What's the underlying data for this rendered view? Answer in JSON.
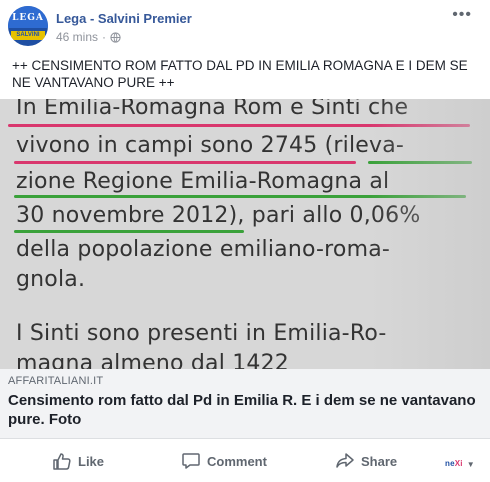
{
  "header": {
    "page_name": "Lega - Salvini Premier",
    "time": "46 mins",
    "dot": "·",
    "avatar_text": "LEGA",
    "avatar_band": "SALVINI"
  },
  "post": {
    "text": "++ CENSIMENTO ROM FATTO DAL PD IN EMILIA ROMAGNA E I DEM SE NE VANTAVANO PURE ++"
  },
  "photo": {
    "lines": [
      "In Emilia-Romagna Rom e Sinti che",
      "vivono in campi sono 2745 (rileva-",
      "zione Regione Emilia-Romagna al",
      "30 novembre 2012), pari allo 0,06%",
      "della popolazione emiliano-roma-",
      "gnola.",
      "I Sinti sono presenti in Emilia-Ro-",
      "magna almeno dal 1422"
    ]
  },
  "link": {
    "domain": "AFFARITALIANI.IT",
    "title": "Censimento rom fatto dal Pd in Emilia R. E i dem se ne vantavano pure. Foto"
  },
  "actions": {
    "like": "Like",
    "comment": "Comment",
    "share": "Share",
    "nexi_brand_a": "ne",
    "nexi_brand_b": "Xi",
    "nexi_caret": "▼"
  },
  "colors": {
    "link_blue": "#365899",
    "underline_pink": "#d9376e",
    "underline_green": "#3aa13a"
  }
}
